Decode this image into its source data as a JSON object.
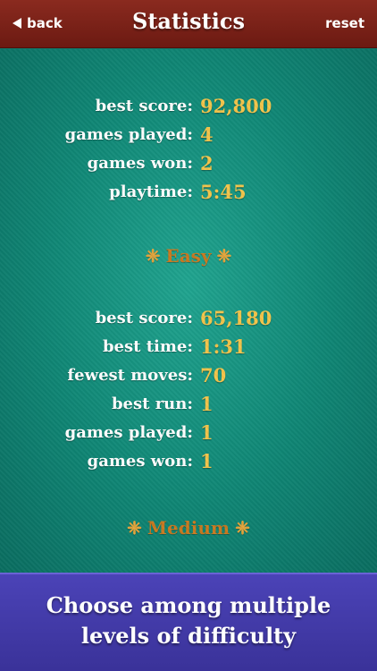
{
  "navbar": {
    "back_label": "back",
    "title": "Statistics",
    "reset_label": "reset"
  },
  "overall": {
    "rows": [
      {
        "label": "best score:",
        "value": "92,800"
      },
      {
        "label": "games played:",
        "value": "4"
      },
      {
        "label": "games won:",
        "value": "2"
      },
      {
        "label": "playtime:",
        "value": "5:45"
      }
    ]
  },
  "easy": {
    "title": "Easy",
    "rows": [
      {
        "label": "best score:",
        "value": "65,180"
      },
      {
        "label": "best time:",
        "value": "1:31"
      },
      {
        "label": "fewest moves:",
        "value": "70"
      },
      {
        "label": "best run:",
        "value": "1"
      },
      {
        "label": "games played:",
        "value": "1"
      },
      {
        "label": "games won:",
        "value": "1"
      }
    ]
  },
  "medium": {
    "title": "Medium"
  },
  "banner": {
    "line1": "Choose among multiple",
    "line2": "levels of difficulty"
  },
  "colors": {
    "navbar": "#7a2218",
    "felt": "#0f8574",
    "value": "#f3c44a",
    "section": "#c9791f",
    "banner": "#4238a8"
  }
}
